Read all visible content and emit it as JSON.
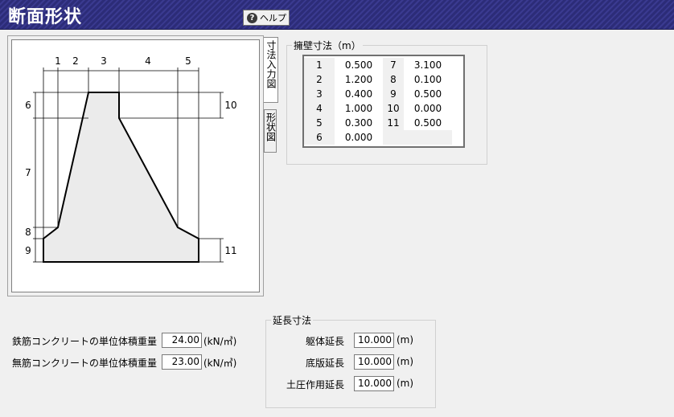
{
  "window": {
    "title": "断面形状",
    "help_label": "ヘルプ"
  },
  "tabs": {
    "dimension_input": "寸法入力図",
    "shape": "形状図"
  },
  "diagram": {
    "top_labels": [
      "1",
      "2",
      "3",
      "4",
      "5"
    ],
    "left_labels": [
      "6",
      "7",
      "8",
      "9"
    ],
    "right_labels": [
      "10",
      "11"
    ]
  },
  "wall_dimensions": {
    "legend": "擁壁寸法（m）",
    "rows": [
      {
        "no": "1",
        "value": "0.500",
        "no2": "7",
        "value2": "3.100"
      },
      {
        "no": "2",
        "value": "1.200",
        "no2": "8",
        "value2": "0.100"
      },
      {
        "no": "3",
        "value": "0.400",
        "no2": "9",
        "value2": "0.500"
      },
      {
        "no": "4",
        "value": "1.000",
        "no2": "10",
        "value2": "0.000"
      },
      {
        "no": "5",
        "value": "0.300",
        "no2": "11",
        "value2": "0.500"
      },
      {
        "no": "6",
        "value": "0.000",
        "no2": "",
        "value2": ""
      }
    ]
  },
  "unit_weights": {
    "rc_label": "鉄筋コンクリートの単位体積重量",
    "rc_value": "24.00",
    "rc_unit": "(kN/㎥)",
    "plain_label": "無筋コンクリートの単位体積重量",
    "plain_value": "23.00",
    "plain_unit": "(kN/㎥)"
  },
  "extension": {
    "legend": "延長寸法",
    "body_label": "躯体延長",
    "body_value": "10.000",
    "base_label": "底版延長",
    "base_value": "10.000",
    "earth_label": "土圧作用延長",
    "earth_value": "10.000",
    "unit": "(m)"
  }
}
